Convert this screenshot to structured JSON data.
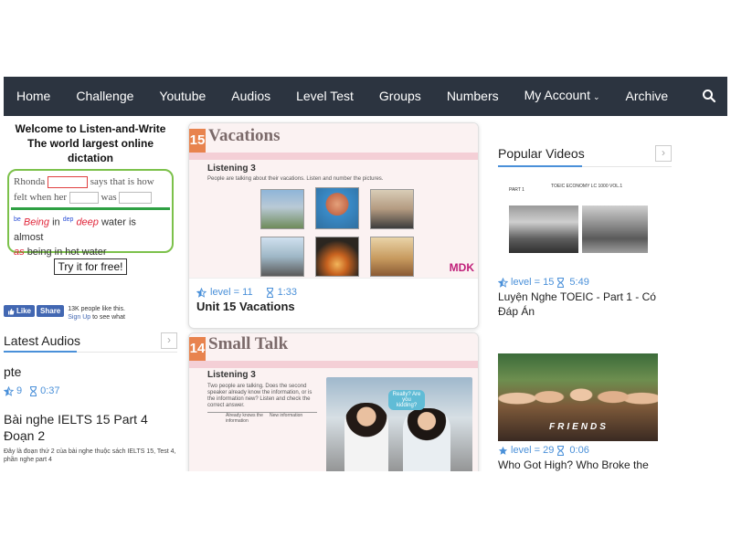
{
  "nav": {
    "items": [
      "Home",
      "Challenge",
      "Youtube",
      "Audios",
      "Level Test",
      "Groups",
      "Numbers",
      "My Account",
      "Archive"
    ],
    "dropdown_index": 7
  },
  "welcome": {
    "line1": "Welcome to Listen-and-Write",
    "line2": "The world largest online",
    "line3": "dictation"
  },
  "demo": {
    "w_rhonda": "Rhonda",
    "w_says": "says that is how",
    "w_felt": "felt when her",
    "w_was": "was",
    "ans_sup1": "be",
    "ans_being": "Being",
    "ans_in": "in",
    "ans_sup2": "dep",
    "ans_deep": "deep",
    "ans_rest": "water is almost",
    "ans_as": "as",
    "ans_end": "being in hot water"
  },
  "try_button": "Try it for free!",
  "facebook": {
    "like": "Like",
    "share": "Share",
    "count_text": "13K people like this.",
    "signup": "Sign Up",
    "signup_rest": "to see what"
  },
  "latest": {
    "title": "Latest Audios",
    "items": [
      {
        "title": "pte",
        "level": "9",
        "duration": "0:37",
        "desc": ""
      },
      {
        "title": "Bài nghe IELTS 15 Part 4 Đoạn 2",
        "level": "",
        "duration": "",
        "desc": "Đây là đoạn thứ 2 của bài nghe thuộc sách IELTS 15, Test 4, phần nghe part 4"
      }
    ]
  },
  "cards": [
    {
      "num": "15",
      "cover_title": "Vacations",
      "listening": "Listening 3",
      "instruction": "People are talking about their vacations. Listen and number the pictures.",
      "publisher": "MDK",
      "level_text": "level = 11",
      "duration": "1:33",
      "title": "Unit 15 Vacations"
    },
    {
      "num": "14",
      "cover_title": "Small Talk",
      "listening": "Listening 3",
      "instruction": "Two people are talking. Does the second speaker already know the information, or is the information new? Listen and check the correct answer.",
      "col1": "Already knows the information",
      "col2": "New information",
      "bubble": "Really? Are you kidding?"
    }
  ],
  "popular": {
    "title": "Popular Videos",
    "videos": [
      {
        "level_text": "level = 15",
        "duration": "5:49",
        "title": "Luyện Nghe TOEIC - Part 1 - Có Đáp Án",
        "thumb_caption": "TOEIC ECONOMY LC 1000 VOL.1",
        "thumb_part": "PART 1"
      },
      {
        "level_text": "level = 29",
        "duration": "0:06",
        "title": "Who Got High? Who Broke the",
        "thumb_caption": "FRIENDS"
      }
    ]
  },
  "colors": {
    "nav_bg": "#2c3440",
    "accent_blue": "#4a90d9",
    "demo_border": "#7cc14b",
    "cover_orange": "#e8834e",
    "mdk": "#c0207a"
  }
}
